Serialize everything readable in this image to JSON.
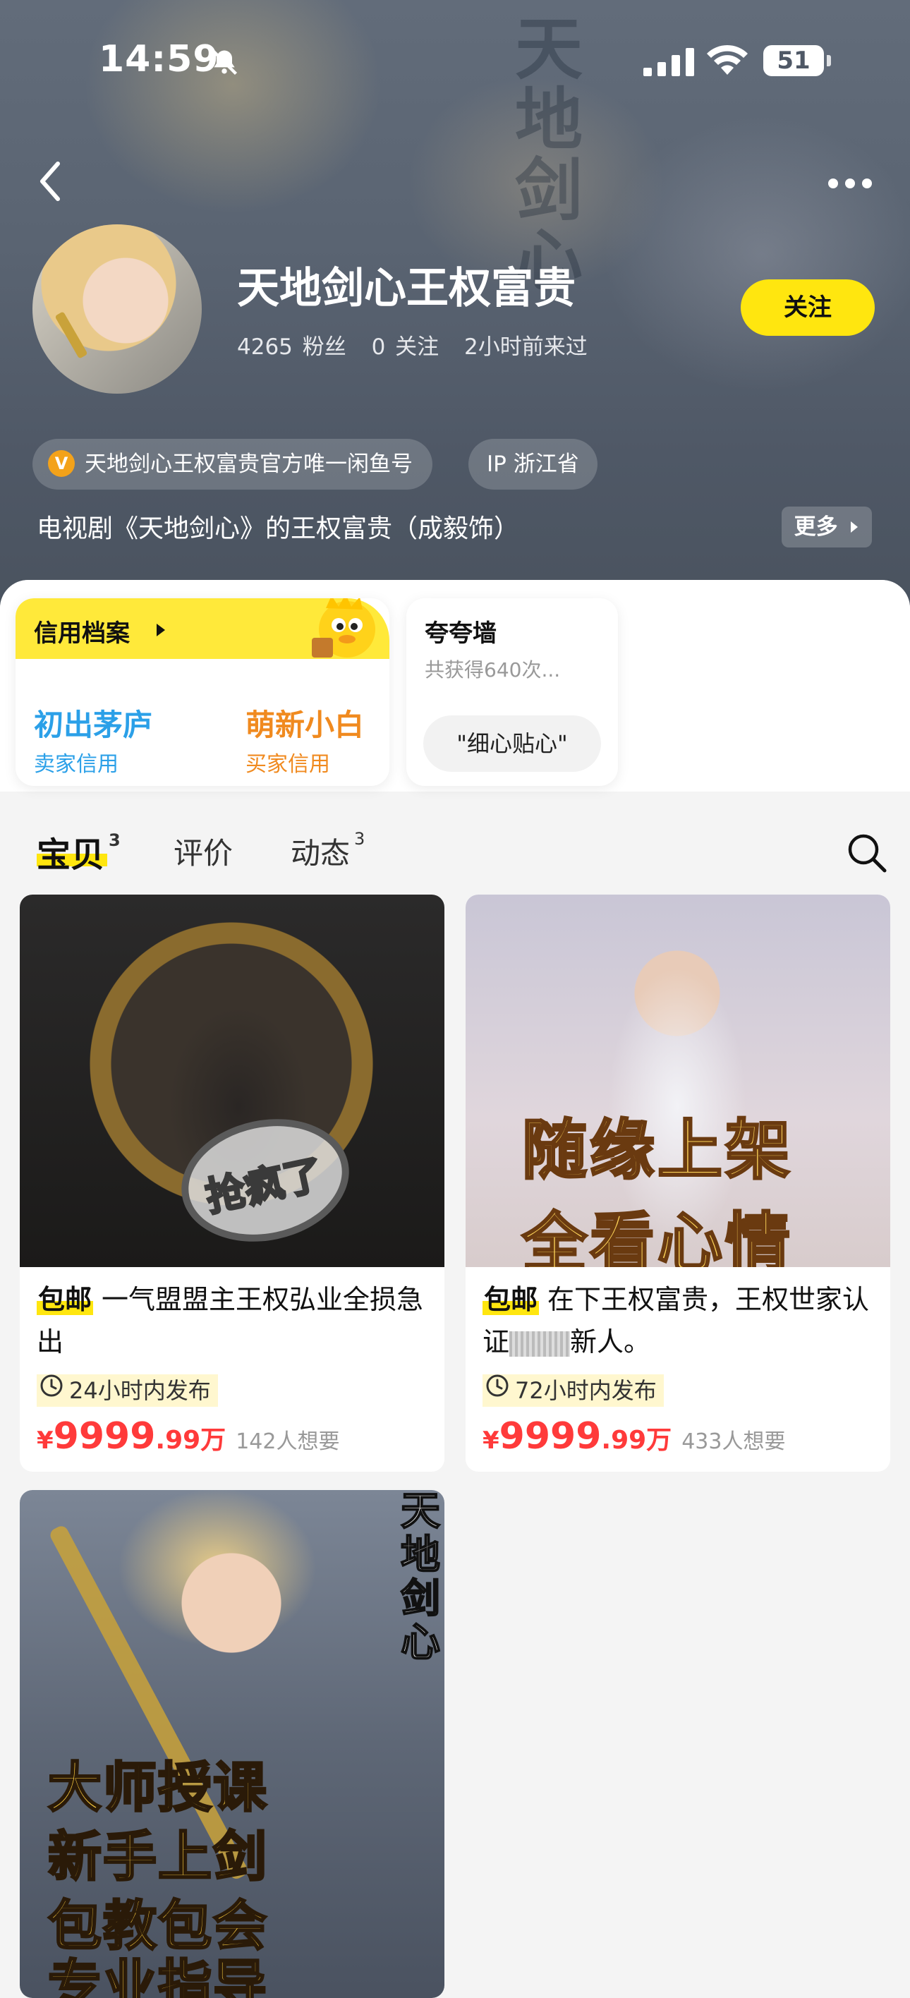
{
  "status_bar": {
    "time": "14:59",
    "battery": "51"
  },
  "profile": {
    "name": "天地剑心王权富贵",
    "fans": "4265 粉丝",
    "following": "0 关注",
    "last_seen": "2小时前来过",
    "follow_label": "关注",
    "verified_badge": "V",
    "verified_tag": "天地剑心王权富贵官方唯一闲鱼号",
    "ip_tag": "IP 浙江省",
    "bio": "电视剧《天地剑心》的王权富贵（成毅饰）",
    "more_label": "更多"
  },
  "credit": {
    "title": "信用档案",
    "seller_value": "初出茅庐",
    "seller_label": "卖家信用",
    "buyer_value": "萌新小白",
    "buyer_label": "买家信用"
  },
  "praise": {
    "title": "夸夸墙",
    "subtitle": "共获得640次...",
    "tag": "\"细心贴心\""
  },
  "tabs": [
    {
      "label": "宝贝",
      "count": "3"
    },
    {
      "label": "评价",
      "count": ""
    },
    {
      "label": "动态",
      "count": "3"
    }
  ],
  "products": [
    {
      "badge": "包邮",
      "title": "一气盟盟主王权弘业全损急出",
      "image_text": "抢疯了",
      "published": "24小时内发布",
      "currency": "¥",
      "price_int": "9999",
      "price_dec": ".99万",
      "wants": "142人想要"
    },
    {
      "badge": "包邮",
      "title_a": "在下王权富贵，王权世家认证",
      "title_b": "新人。",
      "image_text_1": "随缘上架",
      "image_text_2": "全看心情",
      "published": "72小时内发布",
      "currency": "¥",
      "price_int": "9999",
      "price_dec": ".99万",
      "wants": "433人想要"
    },
    {
      "image_side_text": "天地剑心",
      "image_lines": [
        "大师授课",
        "新手上剑",
        "包教包会",
        "专业指导"
      ]
    }
  ],
  "colors": {
    "accent_yellow": "#ffe60f",
    "price_red": "#ff3a3a",
    "seller_blue": "#2ba0e8",
    "buyer_orange": "#f08a1f"
  }
}
